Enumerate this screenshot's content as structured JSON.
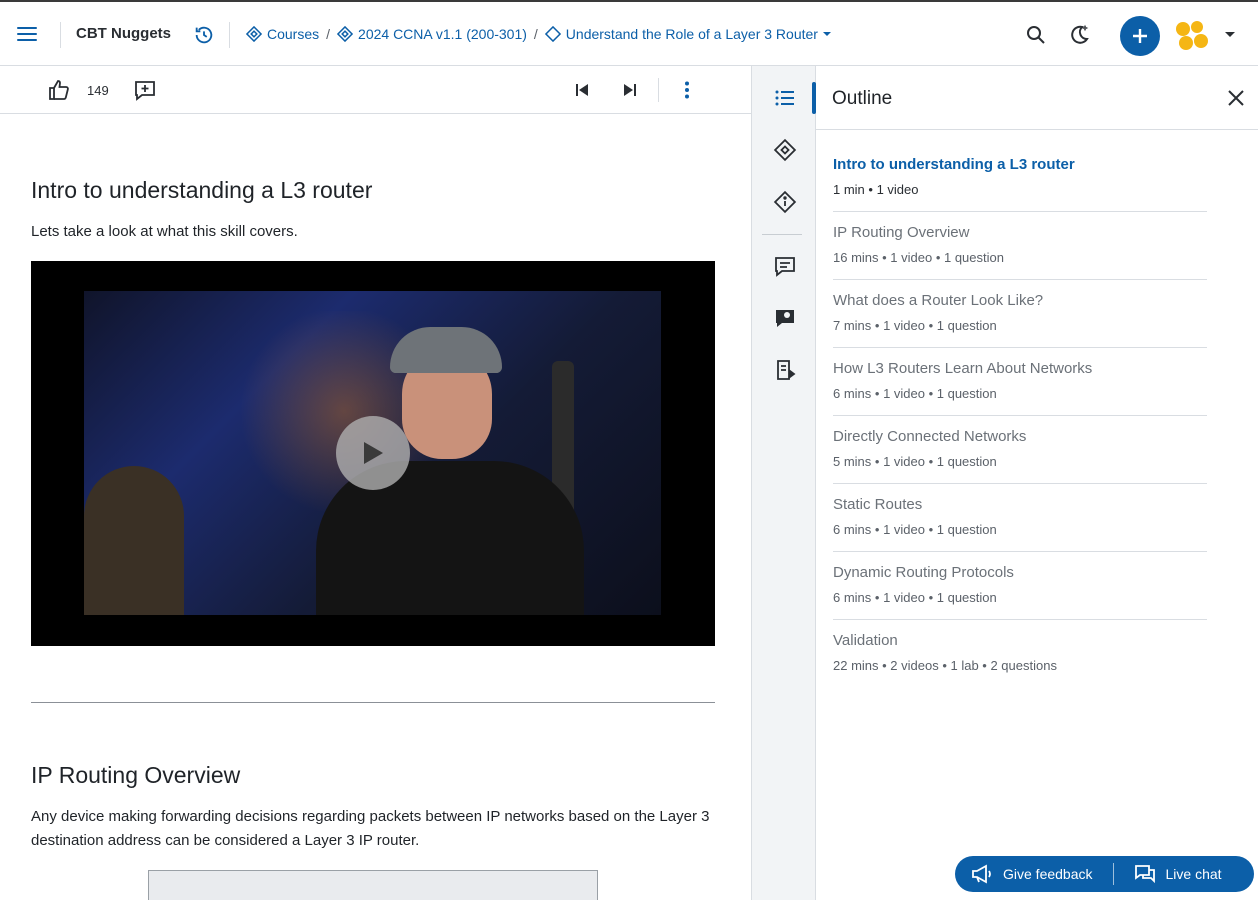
{
  "header": {
    "brand": "CBT Nuggets",
    "breadcrumbs": [
      "Courses",
      "2024 CCNA v1.1 (200-301)",
      "Understand the Role of a Layer 3 Router"
    ]
  },
  "toolbar": {
    "like_count": "149"
  },
  "content": {
    "sections": [
      {
        "title": "Intro to understanding a L3 router",
        "text": "Lets take a look at what this skill covers."
      },
      {
        "title": "IP Routing Overview",
        "text": "Any device making forwarding decisions regarding packets between IP networks based on the Layer 3 destination address can be considered a Layer 3 IP router."
      }
    ]
  },
  "outline": {
    "title": "Outline",
    "items": [
      {
        "title": "Intro to understanding a L3 router",
        "meta": "1 min  •  1 video",
        "active": true
      },
      {
        "title": "IP Routing Overview",
        "meta": "16 mins  •  1 video  •  1 question"
      },
      {
        "title": "What does a Router Look Like?",
        "meta": "7 mins  •  1 video  •  1 question"
      },
      {
        "title": "How L3 Routers Learn About Networks",
        "meta": "6 mins  •  1 video  •  1 question"
      },
      {
        "title": "Directly Connected Networks",
        "meta": "5 mins  •  1 video  •  1 question"
      },
      {
        "title": "Static Routes",
        "meta": "6 mins  •  1 video  •  1 question"
      },
      {
        "title": "Dynamic Routing Protocols",
        "meta": "6 mins  •  1 video  •  1 question"
      },
      {
        "title": "Validation",
        "meta": "22 mins  •  2 videos  •  1 lab  •  2 questions"
      }
    ]
  },
  "footer": {
    "feedback_label": "Give feedback",
    "chat_label": "Live chat"
  },
  "colors": {
    "accent": "#0c5fa8",
    "rail_bg": "#f2f4f6",
    "border": "#d9dde2"
  }
}
